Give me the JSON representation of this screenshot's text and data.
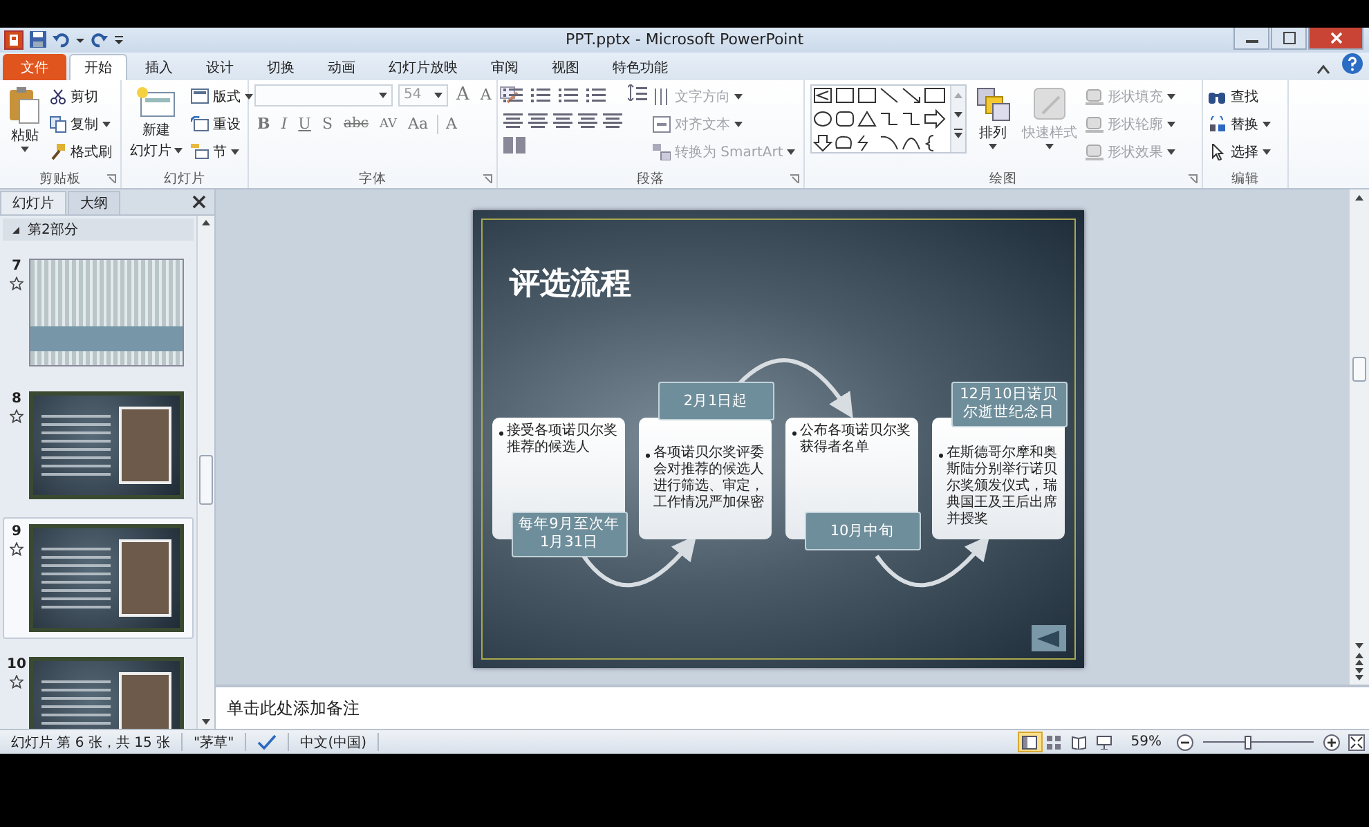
{
  "window": {
    "title": "PPT.pptx - Microsoft PowerPoint"
  },
  "tabs": [
    {
      "label": "文件",
      "kind": "file",
      "selected": false
    },
    {
      "label": "开始",
      "kind": "tab",
      "selected": true
    },
    {
      "label": "插入",
      "kind": "tab",
      "selected": false
    },
    {
      "label": "设计",
      "kind": "tab",
      "selected": false
    },
    {
      "label": "切换",
      "kind": "tab",
      "selected": false
    },
    {
      "label": "动画",
      "kind": "tab",
      "selected": false
    },
    {
      "label": "幻灯片放映",
      "kind": "tab",
      "selected": false
    },
    {
      "label": "审阅",
      "kind": "tab",
      "selected": false
    },
    {
      "label": "视图",
      "kind": "tab",
      "selected": false
    },
    {
      "label": "特色功能",
      "kind": "tab",
      "selected": false
    }
  ],
  "ribbon": {
    "clipboard": {
      "title": "剪贴板",
      "paste": "粘贴",
      "cut": "剪切",
      "copy": "复制",
      "format_painter": "格式刷"
    },
    "slides": {
      "title": "幻灯片",
      "new_slide": [
        "新建",
        "幻灯片"
      ],
      "layout": "版式",
      "reset": "重设",
      "section": "节"
    },
    "font": {
      "title": "字体",
      "font_size": "54",
      "grow": "A",
      "shrink": "A",
      "styles": [
        "B",
        "I",
        "U",
        "S",
        "abc",
        "AV",
        "Aa"
      ],
      "font_color": "A"
    },
    "paragraph": {
      "title": "段落",
      "text_direction": {
        "label": "文字方向",
        "disabled": true
      },
      "align_text": {
        "label": "对齐文本",
        "disabled": true
      },
      "smartart": {
        "label": "转换为 SmartArt",
        "disabled": true
      }
    },
    "drawing": {
      "title": "绘图",
      "arrange": "排列",
      "quick_styles": {
        "label": "快速样式",
        "disabled": true
      },
      "shape_fill": {
        "label": "形状填充",
        "disabled": true
      },
      "shape_outline": {
        "label": "形状轮廓",
        "disabled": true
      },
      "shape_effects": {
        "label": "形状效果",
        "disabled": true
      }
    },
    "editing": {
      "title": "编辑",
      "find": "查找",
      "replace": "替换",
      "select": "选择"
    }
  },
  "slide_panel": {
    "tabs": [
      {
        "label": "幻灯片",
        "selected": true
      },
      {
        "label": "大纲",
        "selected": false
      }
    ],
    "section": {
      "title": "第2部分",
      "expanded": true
    },
    "thumbnails": [
      {
        "number": "7",
        "kind": "title",
        "selected": false
      },
      {
        "number": "8",
        "kind": "content",
        "selected": false
      },
      {
        "number": "9",
        "kind": "content",
        "selected": true
      },
      {
        "number": "10",
        "kind": "content",
        "selected": false
      }
    ]
  },
  "slide": {
    "title": "评选流程",
    "steps": [
      {
        "date": "每年9月至次年1月31日",
        "kind": "below",
        "text": "接受各项诺贝尔奖推荐的候选人"
      },
      {
        "date": "2月1日起",
        "kind": "above",
        "text": "各项诺贝尔奖评委会对推荐的候选人进行筛选、审定，工作情况严加保密"
      },
      {
        "date": "10月中旬",
        "kind": "below",
        "text": "公布各项诺贝尔奖获得者名单"
      },
      {
        "date": "12月10日诺贝尔逝世纪念日",
        "kind": "above",
        "text": "在斯德哥尔摩和奥斯陆分别举行诺贝尔奖颁发仪式，瑞典国王及王后出席并授奖"
      }
    ]
  },
  "notes": {
    "placeholder": "单击此处添加备注"
  },
  "status_bar": {
    "slide_info": "幻灯片 第 6 张，共 15 张",
    "theme": "\"茅草\"",
    "language": "中文(中国)",
    "views": [
      {
        "selected": true
      },
      {
        "selected": false
      },
      {
        "selected": false
      },
      {
        "selected": false
      }
    ],
    "zoom": "59%",
    "zoom_slider": {
      "level": 0.4
    }
  }
}
